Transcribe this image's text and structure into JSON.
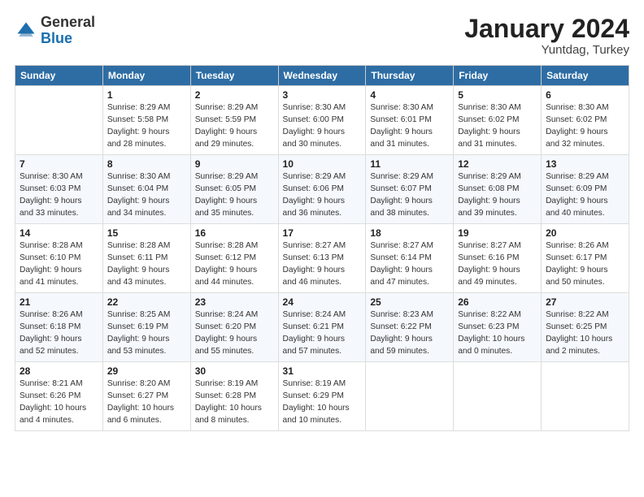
{
  "logo": {
    "general": "General",
    "blue": "Blue"
  },
  "header": {
    "month": "January 2024",
    "location": "Yuntdag, Turkey"
  },
  "weekdays": [
    "Sunday",
    "Monday",
    "Tuesday",
    "Wednesday",
    "Thursday",
    "Friday",
    "Saturday"
  ],
  "weeks": [
    [
      {
        "day": "",
        "info": ""
      },
      {
        "day": "1",
        "info": "Sunrise: 8:29 AM\nSunset: 5:58 PM\nDaylight: 9 hours\nand 28 minutes."
      },
      {
        "day": "2",
        "info": "Sunrise: 8:29 AM\nSunset: 5:59 PM\nDaylight: 9 hours\nand 29 minutes."
      },
      {
        "day": "3",
        "info": "Sunrise: 8:30 AM\nSunset: 6:00 PM\nDaylight: 9 hours\nand 30 minutes."
      },
      {
        "day": "4",
        "info": "Sunrise: 8:30 AM\nSunset: 6:01 PM\nDaylight: 9 hours\nand 31 minutes."
      },
      {
        "day": "5",
        "info": "Sunrise: 8:30 AM\nSunset: 6:02 PM\nDaylight: 9 hours\nand 31 minutes."
      },
      {
        "day": "6",
        "info": "Sunrise: 8:30 AM\nSunset: 6:02 PM\nDaylight: 9 hours\nand 32 minutes."
      }
    ],
    [
      {
        "day": "7",
        "info": "Sunrise: 8:30 AM\nSunset: 6:03 PM\nDaylight: 9 hours\nand 33 minutes."
      },
      {
        "day": "8",
        "info": "Sunrise: 8:30 AM\nSunset: 6:04 PM\nDaylight: 9 hours\nand 34 minutes."
      },
      {
        "day": "9",
        "info": "Sunrise: 8:29 AM\nSunset: 6:05 PM\nDaylight: 9 hours\nand 35 minutes."
      },
      {
        "day": "10",
        "info": "Sunrise: 8:29 AM\nSunset: 6:06 PM\nDaylight: 9 hours\nand 36 minutes."
      },
      {
        "day": "11",
        "info": "Sunrise: 8:29 AM\nSunset: 6:07 PM\nDaylight: 9 hours\nand 38 minutes."
      },
      {
        "day": "12",
        "info": "Sunrise: 8:29 AM\nSunset: 6:08 PM\nDaylight: 9 hours\nand 39 minutes."
      },
      {
        "day": "13",
        "info": "Sunrise: 8:29 AM\nSunset: 6:09 PM\nDaylight: 9 hours\nand 40 minutes."
      }
    ],
    [
      {
        "day": "14",
        "info": "Sunrise: 8:28 AM\nSunset: 6:10 PM\nDaylight: 9 hours\nand 41 minutes."
      },
      {
        "day": "15",
        "info": "Sunrise: 8:28 AM\nSunset: 6:11 PM\nDaylight: 9 hours\nand 43 minutes."
      },
      {
        "day": "16",
        "info": "Sunrise: 8:28 AM\nSunset: 6:12 PM\nDaylight: 9 hours\nand 44 minutes."
      },
      {
        "day": "17",
        "info": "Sunrise: 8:27 AM\nSunset: 6:13 PM\nDaylight: 9 hours\nand 46 minutes."
      },
      {
        "day": "18",
        "info": "Sunrise: 8:27 AM\nSunset: 6:14 PM\nDaylight: 9 hours\nand 47 minutes."
      },
      {
        "day": "19",
        "info": "Sunrise: 8:27 AM\nSunset: 6:16 PM\nDaylight: 9 hours\nand 49 minutes."
      },
      {
        "day": "20",
        "info": "Sunrise: 8:26 AM\nSunset: 6:17 PM\nDaylight: 9 hours\nand 50 minutes."
      }
    ],
    [
      {
        "day": "21",
        "info": "Sunrise: 8:26 AM\nSunset: 6:18 PM\nDaylight: 9 hours\nand 52 minutes."
      },
      {
        "day": "22",
        "info": "Sunrise: 8:25 AM\nSunset: 6:19 PM\nDaylight: 9 hours\nand 53 minutes."
      },
      {
        "day": "23",
        "info": "Sunrise: 8:24 AM\nSunset: 6:20 PM\nDaylight: 9 hours\nand 55 minutes."
      },
      {
        "day": "24",
        "info": "Sunrise: 8:24 AM\nSunset: 6:21 PM\nDaylight: 9 hours\nand 57 minutes."
      },
      {
        "day": "25",
        "info": "Sunrise: 8:23 AM\nSunset: 6:22 PM\nDaylight: 9 hours\nand 59 minutes."
      },
      {
        "day": "26",
        "info": "Sunrise: 8:22 AM\nSunset: 6:23 PM\nDaylight: 10 hours\nand 0 minutes."
      },
      {
        "day": "27",
        "info": "Sunrise: 8:22 AM\nSunset: 6:25 PM\nDaylight: 10 hours\nand 2 minutes."
      }
    ],
    [
      {
        "day": "28",
        "info": "Sunrise: 8:21 AM\nSunset: 6:26 PM\nDaylight: 10 hours\nand 4 minutes."
      },
      {
        "day": "29",
        "info": "Sunrise: 8:20 AM\nSunset: 6:27 PM\nDaylight: 10 hours\nand 6 minutes."
      },
      {
        "day": "30",
        "info": "Sunrise: 8:19 AM\nSunset: 6:28 PM\nDaylight: 10 hours\nand 8 minutes."
      },
      {
        "day": "31",
        "info": "Sunrise: 8:19 AM\nSunset: 6:29 PM\nDaylight: 10 hours\nand 10 minutes."
      },
      {
        "day": "",
        "info": ""
      },
      {
        "day": "",
        "info": ""
      },
      {
        "day": "",
        "info": ""
      }
    ]
  ]
}
